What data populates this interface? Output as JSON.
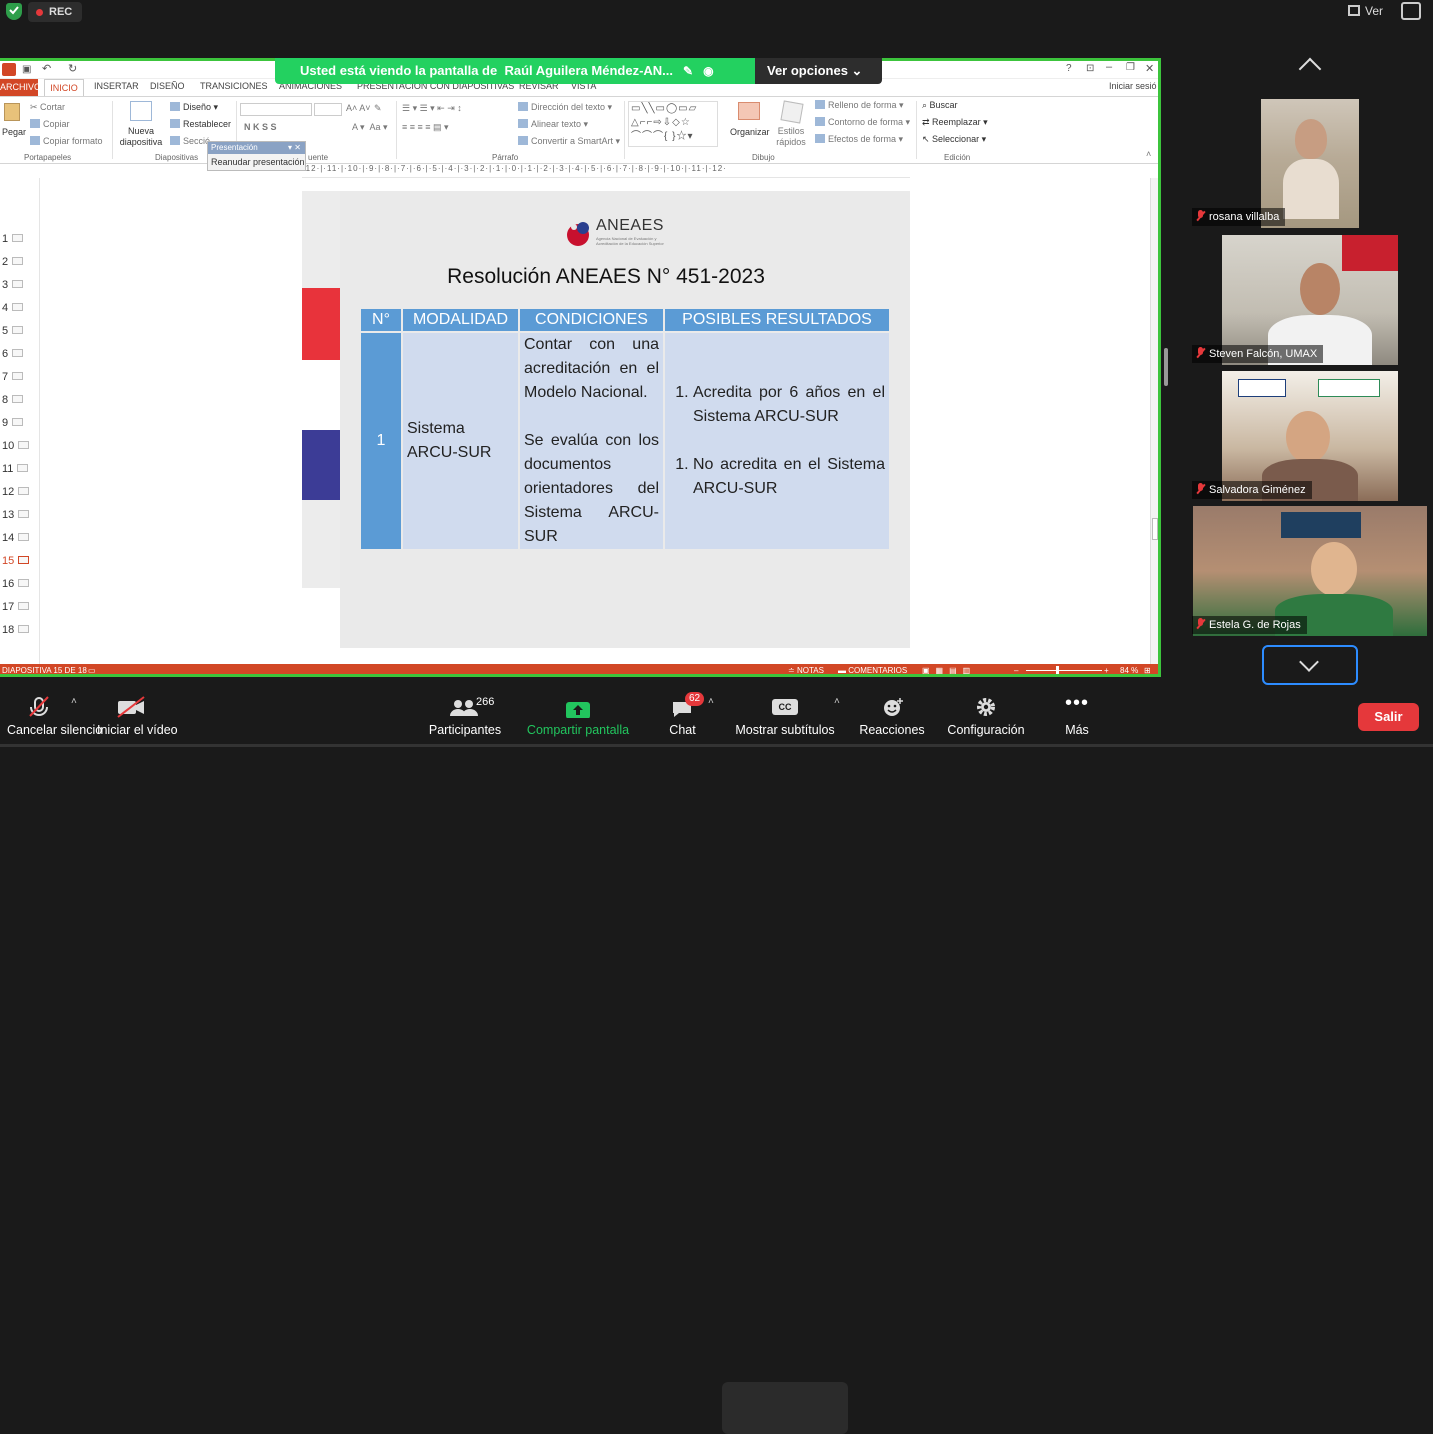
{
  "topbar": {
    "rec_label": "REC",
    "view_label": "Ver"
  },
  "share_banner": {
    "text": "Usted está viendo la pantalla de",
    "presenter": "Raúl Aguilera Méndez-AN...",
    "options_label": "Ver opciones"
  },
  "ppt": {
    "tabs": [
      "ARCHIVO",
      "INICIO",
      "INSERTAR",
      "DISEÑO",
      "TRANSICIONES",
      "ANIMACIONES",
      "PRESENTACIÓN CON DIAPOSITIVAS",
      "REVISAR",
      "VISTA"
    ],
    "signin": "Iniciar sesió",
    "clipboard": {
      "paste": "Pegar",
      "cut": "Cortar",
      "copy": "Copiar",
      "format": "Copiar formato",
      "group": "Portapapeles"
    },
    "slides_group": {
      "new": "Nueva diapositiva",
      "layout": "Diseño",
      "reset": "Restablecer",
      "section": "Secció",
      "group": "Diapositivas"
    },
    "font_group": {
      "group": "uente"
    },
    "paragraph": {
      "text_dir": "Dirección del texto",
      "align": "Alinear texto",
      "smartart": "Convertir a SmartArt",
      "group": "Párrafo"
    },
    "drawing": {
      "arrange": "Organizar",
      "styles": "Estilos rápidos",
      "fill": "Relleno de forma",
      "outline": "Contorno de forma",
      "effects": "Efectos de forma",
      "group": "Dibujo"
    },
    "editing": {
      "find": "Buscar",
      "replace": "Reemplazar",
      "select": "Seleccionar",
      "group": "Edición"
    },
    "popup": {
      "title": "Presentación",
      "item": "Reanudar presentación"
    },
    "ruler": "·12·|·11·|·10·|·9·|·8·|·7·|·6·|·5·|·4·|·3·|·2·|·1·|·0·|·1·|·2·|·3·|·4·|·5·|·6·|·7·|·8·|·9·|·10·|·11·|·12·",
    "thumbs": [
      "1",
      "2",
      "3",
      "4",
      "5",
      "6",
      "7",
      "8",
      "9",
      "10",
      "11",
      "12",
      "13",
      "14",
      "15",
      "16",
      "17",
      "18"
    ],
    "selected_slide": "15",
    "status": {
      "slide": "DIAPOSITIVA 15 DE 18",
      "notes": "NOTAS",
      "comments": "COMENTARIOS",
      "zoom": "84 %"
    }
  },
  "slide": {
    "logo_text": "ANEAES",
    "logo_sub": "Agencia Nacional de Evaluación y Acreditación de la Educación Superior",
    "title": "Resolución ANEAES N° 451-2023",
    "headers": [
      "N°",
      "MODALIDAD",
      "CONDICIONES",
      "POSIBLES RESULTADOS"
    ],
    "row": {
      "num": "1",
      "modalidad": "Sistema ARCU-SUR",
      "cond1": "Contar con una acreditación en el Modelo Nacional.",
      "cond2": "Se evalúa con los documentos orientadores del Sistema ARCU-SUR",
      "res1": "Acredita por 6 años en el Sistema ARCU-SUR",
      "res2": "No acredita en el Sistema ARCU-SUR"
    },
    "stripe_colors": [
      "#d52b1e",
      "#ffffff",
      "#3c3c96"
    ]
  },
  "participants": [
    {
      "name": "rosana villalba"
    },
    {
      "name": "Steven Falcón, UMAX"
    },
    {
      "name": "Salvadora Giménez"
    },
    {
      "name": "Estela G. de Rojas"
    }
  ],
  "toolbar": {
    "mute": "Cancelar silencio",
    "video": "Iniciar el vídeo",
    "participants": "Participantes",
    "participants_count": "266",
    "share": "Compartir pantalla",
    "chat": "Chat",
    "chat_badge": "62",
    "captions": "Mostrar subtítulos",
    "cc": "CC",
    "reactions": "Reacciones",
    "settings": "Configuración",
    "more": "Más",
    "leave": "Salir"
  },
  "colors": {
    "accent_green": "#23d160",
    "ppt_orange": "#d24726",
    "table_blue": "#5b9bd5",
    "table_cell": "#d0dbee",
    "leave_red": "#e5383b"
  }
}
